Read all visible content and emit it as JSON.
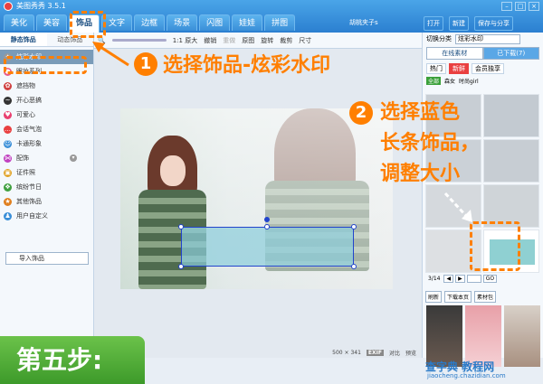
{
  "app": {
    "title": "美图秀秀 3.5.1",
    "user": "胡桃夹子s"
  },
  "window": {
    "controls": [
      "–",
      "□",
      "×"
    ]
  },
  "tabs": [
    {
      "label": "美化"
    },
    {
      "label": "美容"
    },
    {
      "label": "饰品"
    },
    {
      "label": "文字"
    },
    {
      "label": "边框"
    },
    {
      "label": "场景"
    },
    {
      "label": "闪图"
    },
    {
      "label": "娃娃"
    },
    {
      "label": "拼图"
    }
  ],
  "active_tab": "饰品",
  "top_actions": {
    "open": "打开",
    "new": "新建",
    "save": "保存与分享"
  },
  "left": {
    "subtabs": [
      "静态饰品",
      "动态饰品"
    ],
    "categories": [
      {
        "label": "炫彩水印",
        "icon": "sparkle-icon",
        "color": "#999999"
      },
      {
        "label": "眼妆系列",
        "icon": "eye-icon",
        "color": "#e85a8a"
      },
      {
        "label": "遮挡物",
        "icon": "flower-icon",
        "color": "#d04040"
      },
      {
        "label": "开心恶搞",
        "icon": "mustache-icon",
        "color": "#333333"
      },
      {
        "label": "可爱心",
        "icon": "heart-icon",
        "color": "#e94070"
      },
      {
        "label": "会话气泡",
        "icon": "speech-bubble-icon",
        "color": "#e94040"
      },
      {
        "label": "卡通形象",
        "icon": "cartoon-icon",
        "color": "#3a8fd8"
      },
      {
        "label": "配饰",
        "icon": "bow-icon",
        "color": "#c040c0"
      },
      {
        "label": "证件照",
        "icon": "id-photo-icon",
        "color": "#e0a020"
      },
      {
        "label": "缤纷节日",
        "icon": "gift-icon",
        "color": "#40a040"
      },
      {
        "label": "其他饰品",
        "icon": "star-icon",
        "color": "#e08020"
      },
      {
        "label": "用户自定义",
        "icon": "user-icon",
        "color": "#3a8fd8"
      }
    ],
    "import_label": "导入饰品"
  },
  "toolbar": {
    "zoom_label": "1:1 原大",
    "undo": "撤销",
    "redo": "重做",
    "original": "原图",
    "rotate": "旋转",
    "crop": "裁剪",
    "size": "尺寸"
  },
  "status": {
    "dims": "500 × 341",
    "exif": "EXIF",
    "compare": "对比",
    "preview": "预览"
  },
  "right": {
    "switch_label": "切换分类",
    "switch_value": "炫彩水印",
    "tabs": [
      "在线素材",
      "已下载(7)"
    ],
    "tags1": [
      "热门",
      "新鲜",
      "会员独享"
    ],
    "tags2": [
      "全部",
      "森女",
      "时尚girl"
    ],
    "page": "3/14",
    "page_input": "",
    "go": "GO",
    "refresh": "刷新",
    "download_page": "下载本页",
    "pack": "素材包"
  },
  "annotations": {
    "step1": "选择饰品-炫彩水印",
    "step2_line1": "选择蓝色",
    "step2_line2": "长条饰品，",
    "step2_line3": "调整大小",
    "num1": "1",
    "num2": "2",
    "badge": "第五步:"
  },
  "watermark": {
    "site": "查字典 教程网",
    "url": "jiaocheng.chazidian.com"
  }
}
